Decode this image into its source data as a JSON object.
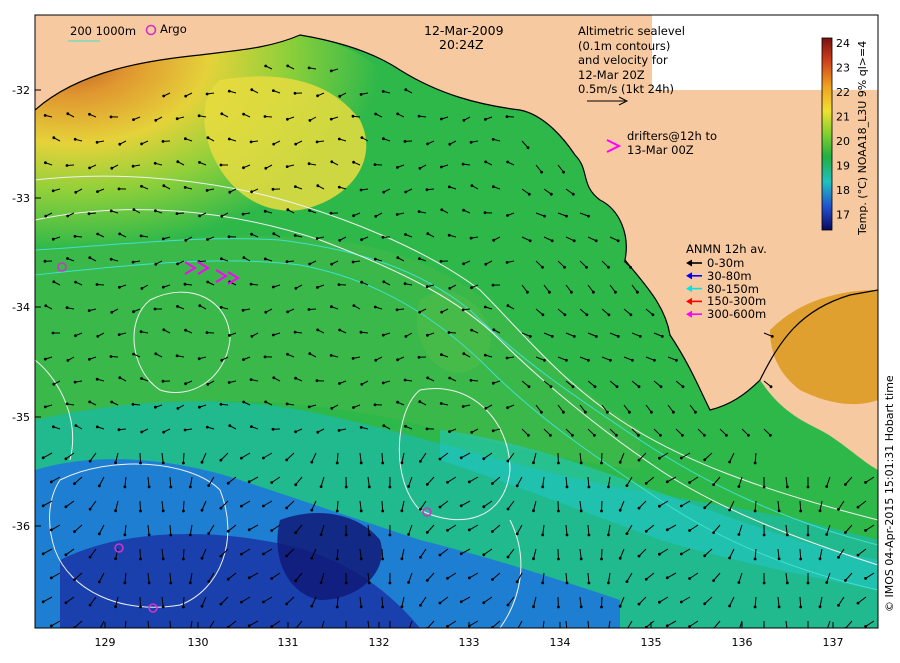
{
  "header": {
    "date": "12-Mar-2009",
    "time": "20:24Z"
  },
  "topleft_legend": {
    "isobath_labels": "200  1000m",
    "argo_label": "Argo"
  },
  "altimetry_note": {
    "lines": [
      "Altimetric sealevel",
      "(0.1m contours)",
      "and velocity for",
      "12-Mar 20Z",
      "0.5m/s (1kt 24h)"
    ]
  },
  "drifters_note": {
    "symbol": ">",
    "lines": [
      "drifters@12h to",
      "13-Mar 00Z"
    ]
  },
  "anmn_legend": {
    "title": "ANMN 12h av.",
    "items": [
      {
        "label": "0-30m",
        "color": "#000000"
      },
      {
        "label": "30-80m",
        "color": "#0000ff"
      },
      {
        "label": "80-150m",
        "color": "#00e5e5"
      },
      {
        "label": "150-300m",
        "color": "#ff0000"
      },
      {
        "label": "300-600m",
        "color": "#ff00ff"
      }
    ]
  },
  "colorbar": {
    "ticks": [
      "24",
      "23",
      "22",
      "21",
      "20",
      "19",
      "18",
      "17"
    ],
    "label": "Temp. (°C) NOAA18_L3U 9% ql>=4"
  },
  "x_axis": {
    "ticks": [
      "129",
      "130",
      "131",
      "132",
      "133",
      "134",
      "135",
      "136",
      "137"
    ]
  },
  "y_axis": {
    "ticks": [
      "-32",
      "-33",
      "-34",
      "-35",
      "-36"
    ]
  },
  "credit": "© IMOS 04-Apr-2015 15:01:31 Hobart time",
  "colors": {
    "land": "#f7c9a0",
    "argo": "#cc33cc",
    "isobath": "#40e0d0",
    "contour": "#f0f0f0"
  }
}
